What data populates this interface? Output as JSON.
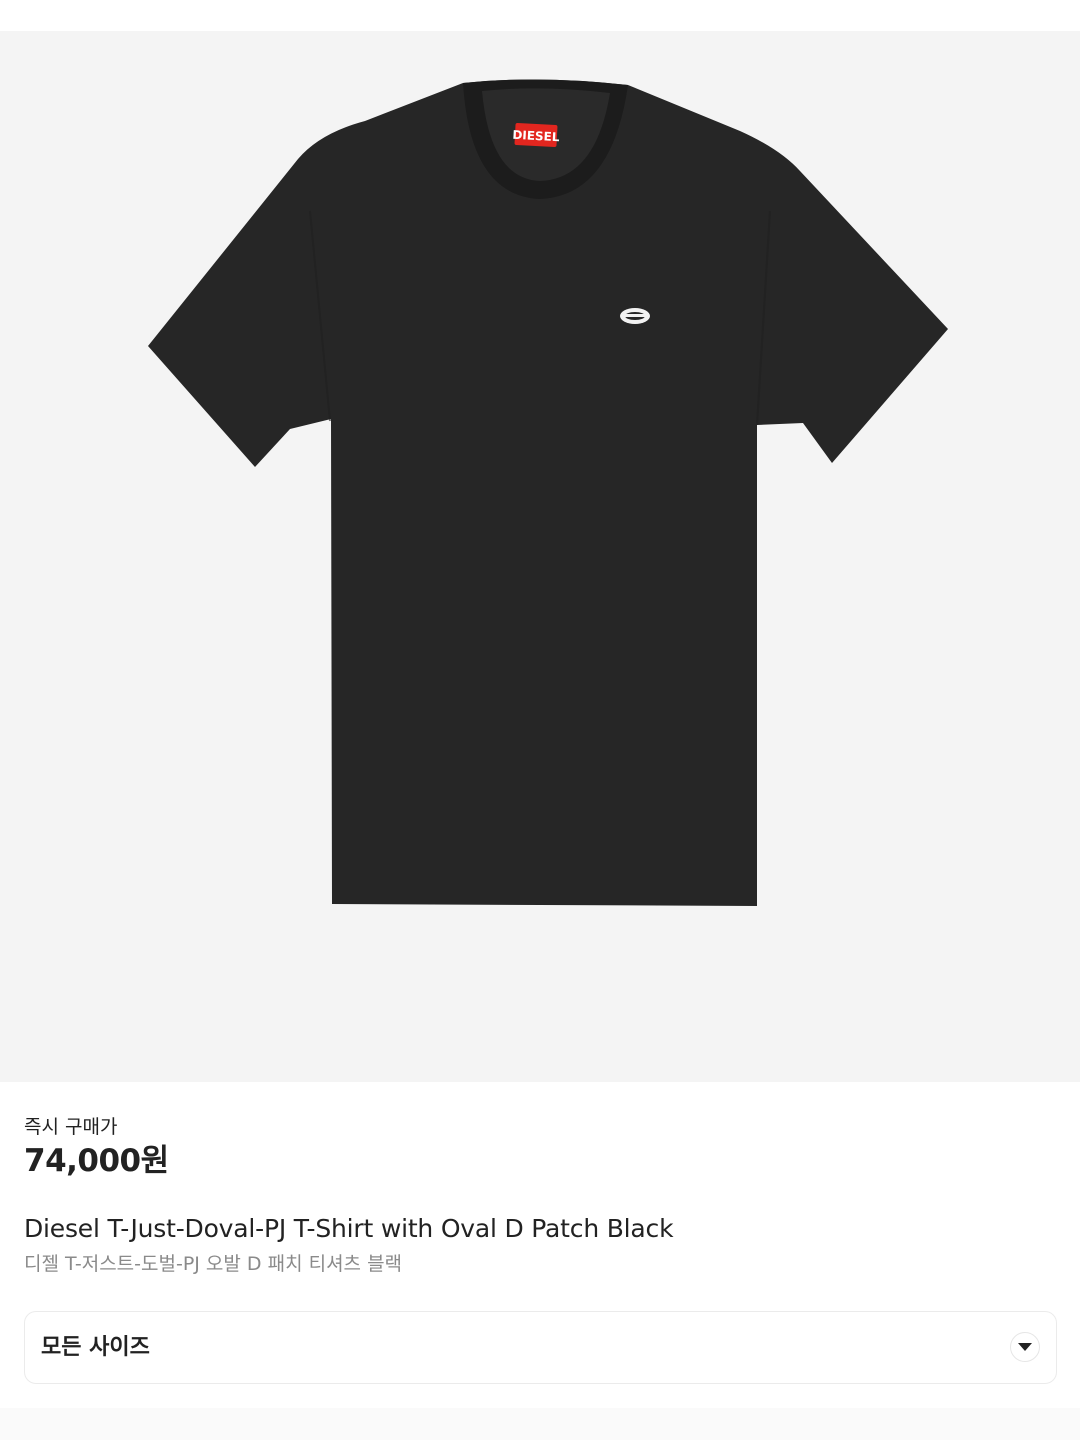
{
  "product": {
    "image_alt": "Diesel black t-shirt",
    "price_label": "즉시 구매가",
    "price": "74,000원",
    "title_en": "Diesel T-Just-Doval-PJ T-Shirt with Oval D Patch Black",
    "title_ko": "디젤 T-저스트-도벌-PJ 오발 D 패치 티셔츠 블랙",
    "brand_tag_text": "DIESEL"
  },
  "size_select": {
    "label": "모든 사이즈",
    "icon": "chevron-down-icon"
  },
  "colors": {
    "image_bg": "#f4f4f4",
    "shirt": "#242424",
    "tag": "#e2261f"
  }
}
